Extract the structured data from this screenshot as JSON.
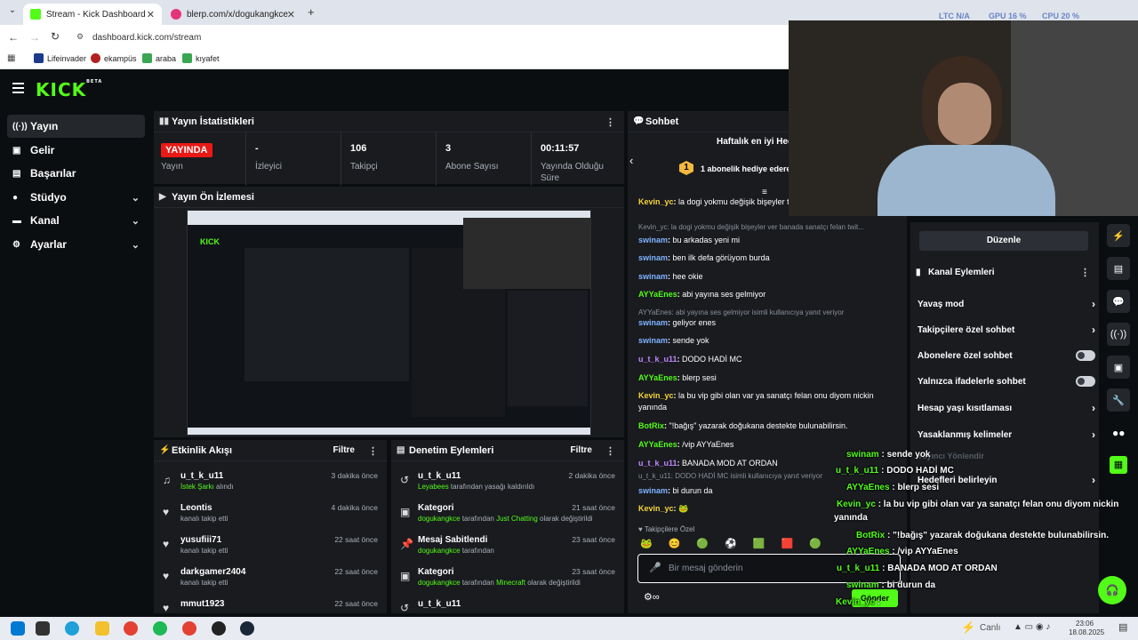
{
  "browser": {
    "tabs": [
      {
        "title": "Stream - Kick Dashboard",
        "active": true
      },
      {
        "title": "blerp.com/x/dogukangkce",
        "active": false
      }
    ],
    "url": "dashboard.kick.com/stream",
    "bookmarks": [
      "Lifeinvader",
      "ekampüs",
      "araba",
      "kıyafet"
    ],
    "sys_stats": [
      "LTC N/A",
      "GPU 16 %",
      "CPU 20 %"
    ]
  },
  "app": {
    "logo": "KICK",
    "logo_sup": "BETA"
  },
  "sidebar": {
    "items": [
      {
        "label": "Yayın",
        "icon": "live-icon",
        "active": true
      },
      {
        "label": "Gelir",
        "icon": "revenue-icon"
      },
      {
        "label": "Başarılar",
        "icon": "achievements-icon"
      },
      {
        "label": "Stüdyo",
        "icon": "studio-icon",
        "expandable": true
      },
      {
        "label": "Kanal",
        "icon": "channel-icon",
        "expandable": true
      },
      {
        "label": "Ayarlar",
        "icon": "gear-icon",
        "expandable": true
      }
    ]
  },
  "stats": {
    "title": "Yayın İstatistikleri",
    "live_badge": "YAYINDA",
    "live_label": "Yayın",
    "items": [
      {
        "value": "-",
        "label": "İzleyici"
      },
      {
        "value": "106",
        "label": "Takipçi"
      },
      {
        "value": "3",
        "label": "Abone Sayısı"
      },
      {
        "value": "00:11:57",
        "label": "Yayında Olduğu Süre"
      }
    ]
  },
  "preview": {
    "title": "Yayın Ön İzlemesi"
  },
  "activity": {
    "title": "Etkinlik Akışı",
    "filter": "Filtre",
    "rows": [
      {
        "name": "u_t_k_u11",
        "desc_hl": "İstek Şarkı",
        "desc": " alındı",
        "time": "3 dakika önce",
        "icon": "music-icon"
      },
      {
        "name": "Leontis",
        "desc": "kanalı takip etti",
        "time": "4 dakika önce",
        "icon": "heart-icon"
      },
      {
        "name": "yusufiii71",
        "desc": "kanalı takip etti",
        "time": "22 saat önce",
        "icon": "heart-icon"
      },
      {
        "name": "darkgamer2404",
        "desc": "kanalı takip etti",
        "time": "22 saat önce",
        "icon": "heart-icon"
      },
      {
        "name": "mmut1923",
        "desc": "",
        "time": "22 saat önce",
        "icon": "heart-icon"
      }
    ]
  },
  "moderation": {
    "title": "Denetim Eylemleri",
    "filter": "Filtre",
    "rows": [
      {
        "name": "u_t_k_u11",
        "hl": "Leyabees",
        "desc": " tarafından yasağı kaldırıldı",
        "time": "2 dakika önce",
        "icon": "undo-icon"
      },
      {
        "name": "Kategori",
        "hl": "dogukangkce",
        "desc": " tarafından ",
        "hl2": "Just Chatting",
        "desc2": " olarak değiştirildi",
        "time": "21 saat önce",
        "icon": "category-icon"
      },
      {
        "name": "Mesaj Sabitlendi",
        "hl": "dogukangkce",
        "desc": " tarafından",
        "time": "23 saat önce",
        "icon": "pin-icon"
      },
      {
        "name": "Kategori",
        "hl": "dogukangkce",
        "desc": " tarafından ",
        "hl2": "Minecraft",
        "desc2": " olarak değiştirildi",
        "time": "23 saat önce",
        "icon": "category-icon"
      },
      {
        "name": "u_t_k_u11",
        "hl": "",
        "desc": "",
        "time": "",
        "icon": "undo-icon"
      }
    ]
  },
  "chat": {
    "title": "Sohbet",
    "leaderboard_title": "Haftalık en iyi Hed",
    "leaderboard_item": "1 abonelik hediye edere",
    "leaderboard_rank": "1",
    "messages": [
      {
        "user": "Kevin_yc",
        "text": "la dogi yokmu değişik bişeyler twitchteki gib",
        "color": "yellow"
      },
      {
        "reply": "Kevin_yc: la dogi yokmu değişik bişeyler ver banada sanatçı felan twit..."
      },
      {
        "user": "swinam",
        "text": "bu arkadas yeni mi",
        "color": "blue"
      },
      {
        "user": "swinam",
        "text": "ben ilk defa görüyom burda",
        "color": "blue"
      },
      {
        "user": "swinam",
        "text": "hee okie",
        "color": "blue"
      },
      {
        "user": "AYYaEnes",
        "text": "abi yayına ses gelmiyor",
        "color": "green"
      },
      {
        "reply": "AYYaEnes: abi yayına ses gelmiyor isimli kullanıcıya yanıt veriyor"
      },
      {
        "user": "swinam",
        "text": "geliyor enes",
        "color": "blue"
      },
      {
        "user": "swinam",
        "text": "sende yok",
        "color": "blue"
      },
      {
        "user": "u_t_k_u11",
        "text": "DODO HADİ MC",
        "color": "purple"
      },
      {
        "user": "AYYaEnes",
        "text": "blerp sesi",
        "color": "green"
      },
      {
        "user": "Kevin_yc",
        "text": "la bu vip gibi olan var ya sanatçı felan onu diyom nickin yanında",
        "color": "yellow"
      },
      {
        "user": "BotRix",
        "text": "\"!bağış\" yazarak doğukana destekte bulunabilirsin.",
        "color": "green"
      },
      {
        "user": "AYYaEnes",
        "text": "/vip AYYaEnes",
        "color": "green"
      },
      {
        "user": "u_t_k_u11",
        "text": "BANADA MOD AT ORDAN",
        "color": "purple"
      },
      {
        "reply": "u_t_k_u11: DODO HADİ MC isimli kullanıcıya yanıt veriyor"
      },
      {
        "user": "swinam",
        "text": "bi durun da",
        "color": "blue"
      },
      {
        "user": "Kevin_yc",
        "text": "🐸",
        "color": "yellow"
      }
    ],
    "followers_label": "Takipçilere Özel",
    "input_placeholder": "Bir mesaj gönderin",
    "send_label": "Gönder"
  },
  "channel_actions": {
    "edit_label": "Düzenle",
    "title": "Kanal Eylemleri",
    "rows": [
      {
        "label": "Yavaş mod",
        "type": "chevron"
      },
      {
        "label": "Takipçilere özel sohbet",
        "type": "chevron"
      },
      {
        "label": "Abonelere özel sohbet",
        "type": "toggle"
      },
      {
        "label": "Yalnızca ifadelerle sohbet",
        "type": "toggle"
      },
      {
        "label": "Hesap yaşı kısıtlaması",
        "type": "chevron"
      },
      {
        "label": "Yasaklanmış kelimeler",
        "type": "chevron"
      },
      {
        "label": "Hedefleri belirleyin",
        "type": "chevron"
      }
    ],
    "faded_label": "Yayıncı Yönlendir"
  },
  "overlay_chat": [
    {
      "user": "swinam",
      "text": " : sende yok"
    },
    {
      "user": "u_t_k_u11",
      "text": " : DODO HADİ MC"
    },
    {
      "user": "AYYaEnes",
      "text": " : blerp sesi"
    },
    {
      "user": "Kevin_yc",
      "text": " : la bu vip gibi olan var ya sanatçı felan onu diyom nickin"
    },
    {
      "user": "",
      "text": "yanında"
    },
    {
      "user": "BotRix",
      "text": " : \"!bağış\" yazarak doğukana destekte bulunabilirsin."
    },
    {
      "user": "AYYaEnes",
      "text": " : /vip AYYaEnes"
    },
    {
      "user": "u_t_k_u11",
      "text": " : BANADA MOD AT ORDAN"
    },
    {
      "user": "swinam",
      "text": " : bi durun da"
    },
    {
      "user": "Kevin_yc",
      "text": " : "
    }
  ],
  "taskbar": {
    "status": "Canlı",
    "time": "23:06",
    "date": "18.08.2025"
  },
  "colors": {
    "accent": "#53fc18",
    "live": "#e91916",
    "bg": "#0b0e11",
    "panel": "#191b1f"
  }
}
